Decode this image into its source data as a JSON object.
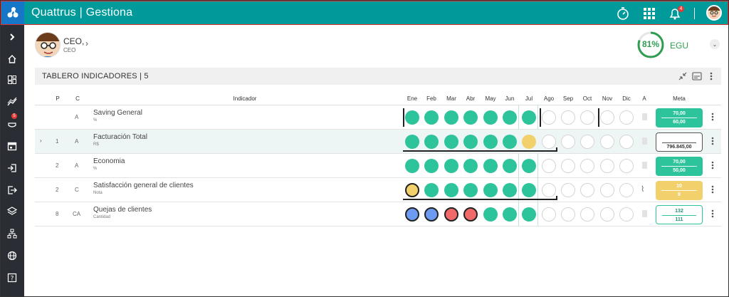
{
  "header": {
    "app_title": "Quattrus | Gestiona",
    "notification_count": "4",
    "icons": [
      "logo-icon",
      "timer-icon",
      "apps-grid-icon",
      "bell-icon",
      "user-avatar"
    ]
  },
  "sidebar": {
    "items": [
      {
        "name": "expand",
        "icon": "chevron-right-icon"
      },
      {
        "name": "home",
        "icon": "home-icon"
      },
      {
        "name": "dashboard",
        "icon": "dashboard-icon"
      },
      {
        "name": "trends",
        "icon": "trend-icon"
      },
      {
        "name": "alerts",
        "icon": "alert-hand-icon",
        "badge": "5"
      },
      {
        "name": "calendar",
        "icon": "calendar-icon"
      },
      {
        "name": "login",
        "icon": "login-icon"
      },
      {
        "name": "logout",
        "icon": "logout-icon"
      },
      {
        "name": "layers",
        "icon": "layers-icon"
      },
      {
        "name": "org",
        "icon": "org-chart-icon"
      },
      {
        "name": "web",
        "icon": "globe-icon"
      },
      {
        "name": "help",
        "icon": "help-icon"
      }
    ]
  },
  "user": {
    "role": "CEO,",
    "sub": "CEO"
  },
  "egu": {
    "percent": "81%",
    "percent_value": 0.81,
    "label": "EGU"
  },
  "panel": {
    "title": "TABLERO INDICADORES | 5"
  },
  "table": {
    "headers": {
      "p": "P",
      "c": "C",
      "indicador": "Indicador",
      "months": [
        "Ene",
        "Feb",
        "Mar",
        "Abr",
        "May",
        "Jun",
        "Jul",
        "Ago",
        "Sep",
        "Oct",
        "Nov",
        "Dic"
      ],
      "a": "A",
      "meta": "Meta"
    },
    "rows": [
      {
        "p": "",
        "c": "A",
        "name": "Saving General",
        "unit": "%",
        "dots": [
          "g",
          "g",
          "g",
          "g",
          "g",
          "g",
          "g",
          "e",
          "e",
          "e",
          "e",
          "e"
        ],
        "meta_top": "70,00",
        "meta_bottom": "60,00",
        "meta_style": "green"
      },
      {
        "p": "1",
        "c": "A",
        "name": "Facturación Total",
        "unit": "R$",
        "dots": [
          "g",
          "g",
          "g",
          "g",
          "g",
          "g",
          "y",
          "e",
          "e",
          "e",
          "e",
          "e"
        ],
        "meta_top": "",
        "meta_bottom": "796.845,00",
        "meta_style": "outline"
      },
      {
        "p": "2",
        "c": "A",
        "name": "Economia",
        "unit": "%",
        "dots": [
          "g",
          "g",
          "g",
          "g",
          "g",
          "g",
          "g",
          "e",
          "e",
          "e",
          "e",
          "e"
        ],
        "meta_top": "70,00",
        "meta_bottom": "50,00",
        "meta_style": "green"
      },
      {
        "p": "2",
        "c": "C",
        "name": "Satisfacción general de clientes",
        "unit": "Nota",
        "dots": [
          "y",
          "g",
          "g",
          "g",
          "g",
          "g",
          "g",
          "e",
          "e",
          "e",
          "e",
          "e"
        ],
        "meta_top": "10",
        "meta_bottom": "9",
        "meta_style": "yellow"
      },
      {
        "p": "8",
        "c": "CA",
        "name": "Quejas de clientes",
        "unit": "Cantidad",
        "dots": [
          "b",
          "b",
          "r",
          "r",
          "g",
          "g",
          "g",
          "e",
          "e",
          "e",
          "e",
          "e"
        ],
        "meta_top": "132",
        "meta_bottom": "111",
        "meta_style": "outline-g"
      }
    ]
  }
}
